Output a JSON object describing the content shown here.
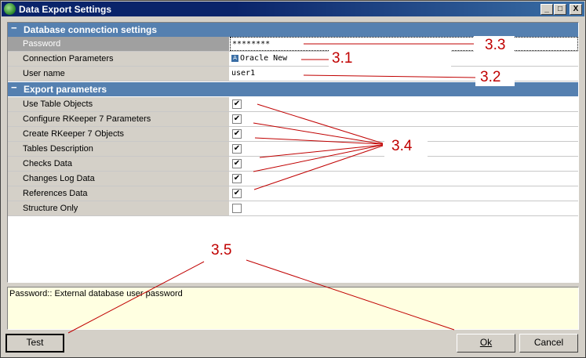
{
  "window": {
    "title": "Data Export Settings",
    "controls": {
      "minimize": "_",
      "maximize": "□",
      "close": "X"
    }
  },
  "sections": {
    "db": "Database connection settings",
    "export": "Export parameters",
    "collapse_glyph": "−"
  },
  "db_rows": {
    "password": {
      "label": "Password",
      "value": "********"
    },
    "connection": {
      "label": "Connection Parameters",
      "value": "Oracle New"
    },
    "user": {
      "label": "User name",
      "value": "user1"
    }
  },
  "export_rows": [
    {
      "label": "Use Table Objects",
      "checked": true
    },
    {
      "label": "Configure RKeeper 7 Parameters",
      "checked": true
    },
    {
      "label": "Create RKeeper 7 Objects",
      "checked": true
    },
    {
      "label": "Tables Description",
      "checked": true
    },
    {
      "label": "Checks Data",
      "checked": true
    },
    {
      "label": "Changes Log Data",
      "checked": true
    },
    {
      "label": "References Data",
      "checked": true
    },
    {
      "label": "Structure Only",
      "checked": false
    }
  ],
  "description": "Password:: External database user password",
  "buttons": {
    "test": "Test",
    "ok": "Ok",
    "cancel": "Cancel"
  },
  "annotations": {
    "a33": "3.3",
    "a31": "3.1",
    "a32": "3.2",
    "a34": "3.4",
    "a35": "3.5"
  },
  "colors": {
    "annotation": "#c00000",
    "section_header": "#5580b0",
    "description_bg": "#ffffe1"
  }
}
